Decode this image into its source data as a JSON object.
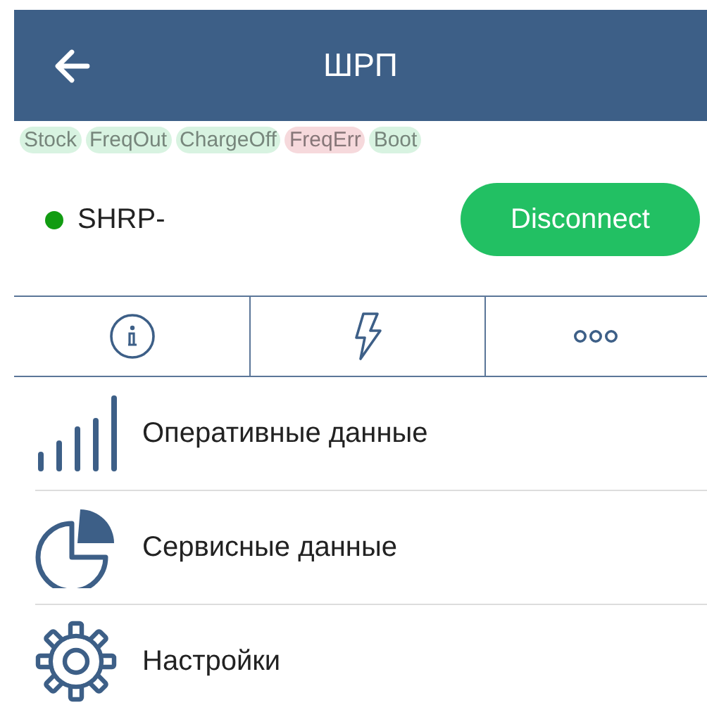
{
  "header": {
    "title": "ШРП"
  },
  "tags": [
    {
      "label": "Stock",
      "color": "#d8f3e1"
    },
    {
      "label": "FreqOut",
      "color": "#d8f3e1"
    },
    {
      "label": "ChargeOff",
      "color": "#d8f3e1"
    },
    {
      "label": "FreqErr",
      "color": "#f6d9dc"
    },
    {
      "label": "Boot",
      "color": "#d8f3e1"
    }
  ],
  "device": {
    "name": "SHRP-",
    "color": "#129c12",
    "button": "Disconnect"
  },
  "tabs": [
    {
      "kind": "info"
    },
    {
      "kind": "flash"
    },
    {
      "kind": "more"
    }
  ],
  "menu": [
    {
      "kind": "bars",
      "label": "Оперативные данные"
    },
    {
      "kind": "pie",
      "label": "Сервисные данные"
    },
    {
      "kind": "gear",
      "label": "Настройки"
    }
  ]
}
